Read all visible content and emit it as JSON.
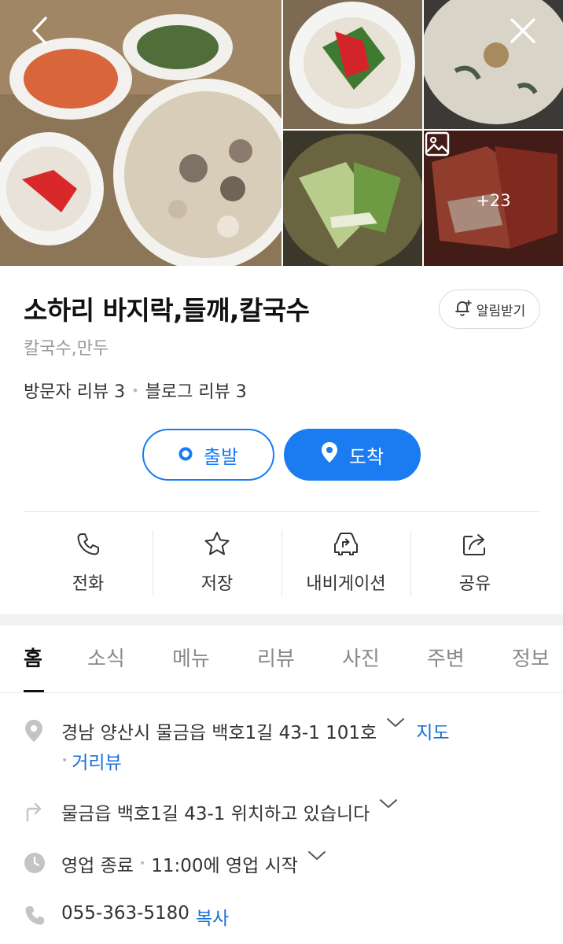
{
  "gallery": {
    "more_count": "+23",
    "back_icon": "chevron-left-icon",
    "close_icon": "close-icon",
    "photos_icon": "image-icon"
  },
  "place": {
    "title": "소하리 바지락,들깨,칼국수",
    "category": "칼국수,만두",
    "visitor_reviews": "방문자 리뷰 3",
    "blog_reviews": "블로그 리뷰 3",
    "alarm_label": "알림받기"
  },
  "route": {
    "start_label": "출발",
    "end_label": "도착",
    "accent": "#1a7cf0"
  },
  "actions": [
    {
      "label": "전화",
      "icon": "phone-icon"
    },
    {
      "label": "저장",
      "icon": "star-icon"
    },
    {
      "label": "내비게이션",
      "icon": "car-navigation-icon"
    },
    {
      "label": "공유",
      "icon": "share-icon"
    }
  ],
  "tabs": [
    "홈",
    "소식",
    "메뉴",
    "리뷰",
    "사진",
    "주변",
    "정보"
  ],
  "info": {
    "address": "경남 양산시 물금읍 백호1길 43-1 101호",
    "map_link": "지도",
    "street_view_link": "거리뷰",
    "directions": "물금읍 백호1길 43-1 위치하고 있습니다",
    "hours_status": "영업 종료",
    "hours_next": "11:00에 영업 시작",
    "phone": "055-363-5180",
    "copy_label": "복사"
  }
}
